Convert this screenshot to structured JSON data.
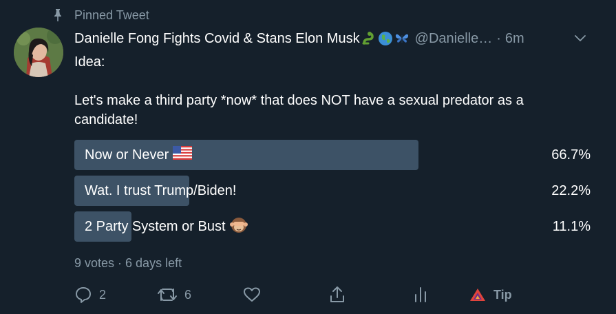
{
  "pinned_label": "Pinned Tweet",
  "author": {
    "name": "Danielle Fong Fights Covid & Stans Elon Musk",
    "name_emojis": [
      "snake-emoji",
      "globe-emoji",
      "butterfly-emoji"
    ],
    "handle": "@Danielle…",
    "separator": "·",
    "time": "6m"
  },
  "tweet_text": "Idea:\n\nLet's make a third party *now* that does NOT have a sexual predator as a candidate!",
  "poll": {
    "options": [
      {
        "label": "Now or Never",
        "emoji": "us-flag-emoji",
        "percent_text": "66.7%",
        "percent": 66.7,
        "leading": true
      },
      {
        "label": "Wat. I trust Trump/Biden!",
        "emoji": "",
        "percent_text": "22.2%",
        "percent": 22.2,
        "leading": false
      },
      {
        "label": "2 Party System or Bust",
        "emoji": "see-no-evil-monkey-emoji",
        "percent_text": "11.1%",
        "percent": 11.1,
        "leading": false
      }
    ],
    "meta": "9 votes · 6 days left"
  },
  "actions": {
    "reply_count": "2",
    "retweet_count": "6",
    "tip_label": "Tip"
  },
  "colors": {
    "background": "#15202b",
    "secondary_text": "#8899a6",
    "poll_bar": "#3d5266",
    "tip_brand": "#e0443c"
  }
}
